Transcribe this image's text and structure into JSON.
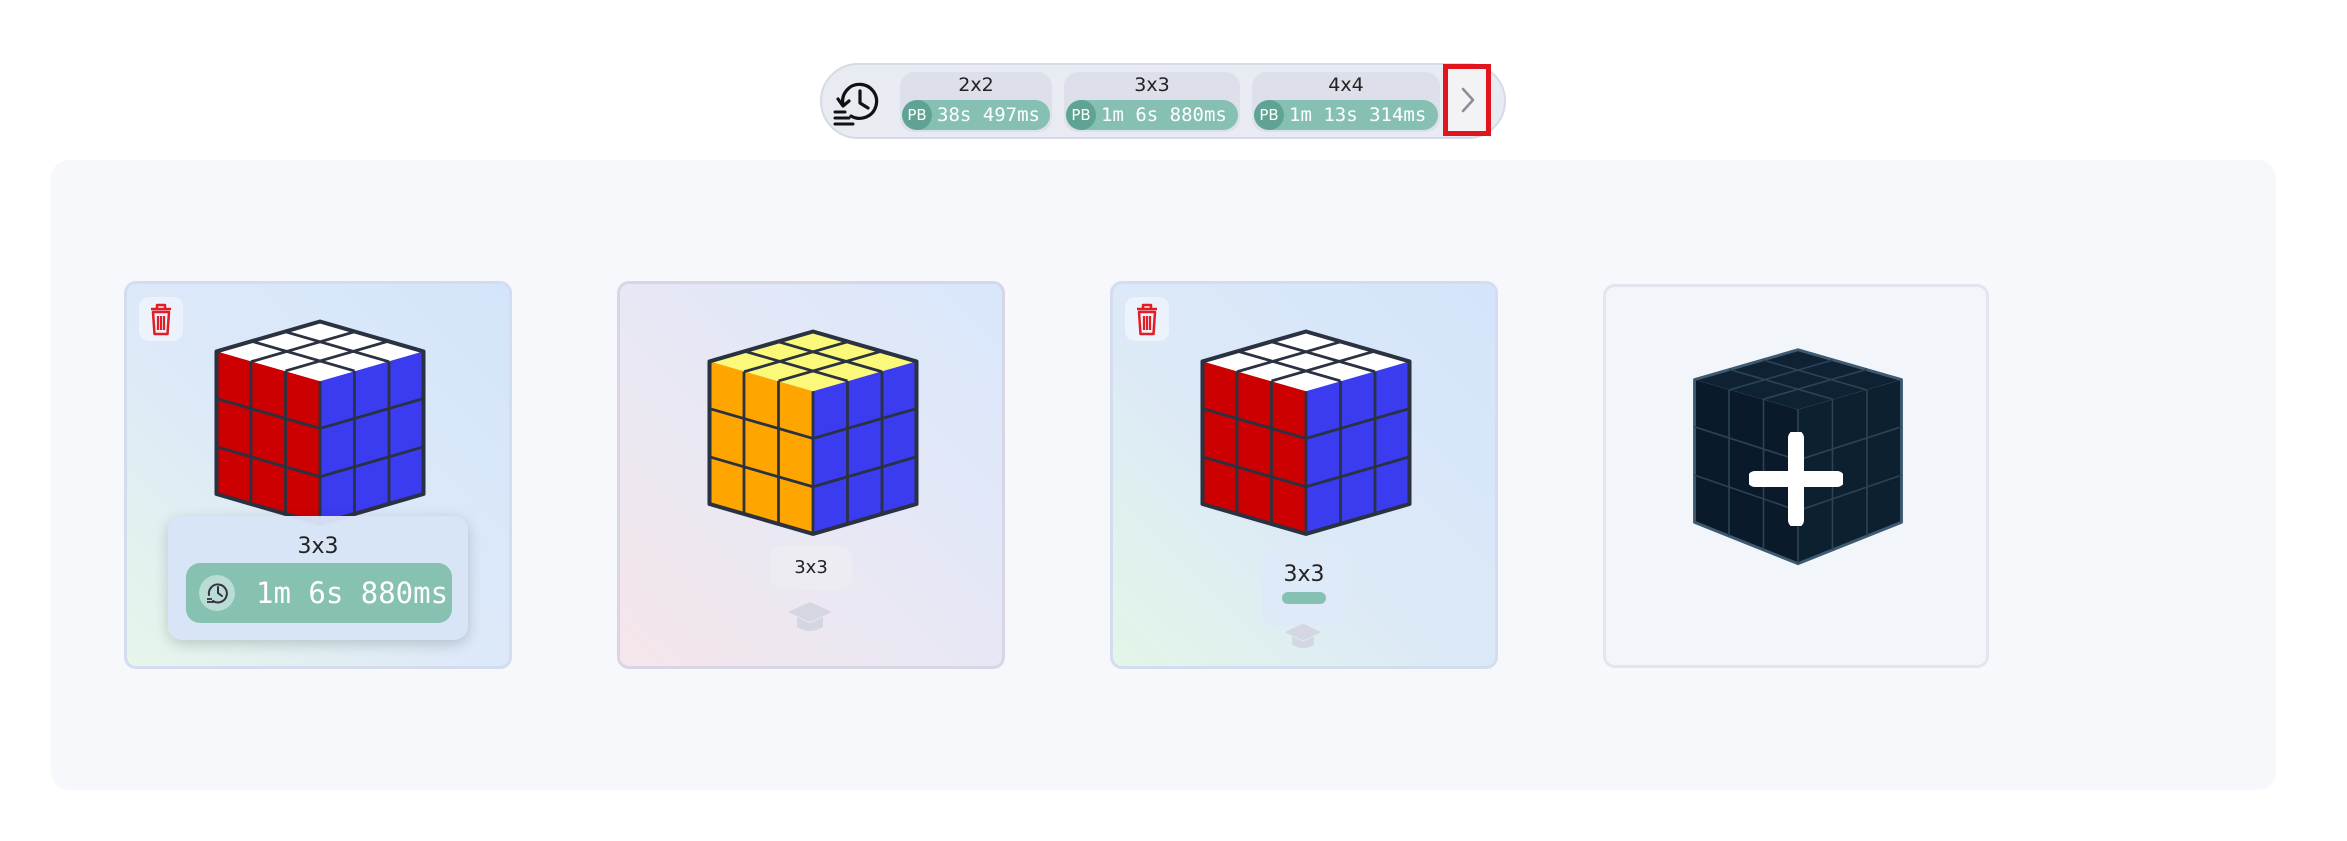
{
  "pb_bar": {
    "chips": [
      {
        "puzzle": "2x2",
        "badge": "PB",
        "time": "38s 497ms"
      },
      {
        "puzzle": "3x3",
        "badge": "PB",
        "time": "1m 6s 880ms"
      },
      {
        "puzzle": "4x4",
        "badge": "PB",
        "time": "1m 13s 314ms"
      }
    ]
  },
  "cards": [
    {
      "label": "3x3",
      "tooltip_title": "3x3",
      "tooltip_time": "1m 6s 880ms",
      "deletable": true
    },
    {
      "label": "3x3",
      "deletable": false
    },
    {
      "label": "3x3",
      "deletable": true
    }
  ],
  "colors": {
    "accent_teal": "#85c0b3",
    "highlight_red": "#e0151d",
    "trash_red": "#e31d25",
    "cube_red": "#cc0000",
    "cube_blue": "#3b3bef",
    "cube_white": "#ffffff",
    "cube_yellow": "#fbf97a",
    "cube_orange": "#ffa500",
    "add_cube_dark": "#0f2233"
  },
  "icons": {
    "history": "history-icon",
    "scroll_right": "chevron-right-icon",
    "delete": "trash-icon",
    "tutorial": "graduation-cap-icon",
    "add": "plus-icon"
  }
}
